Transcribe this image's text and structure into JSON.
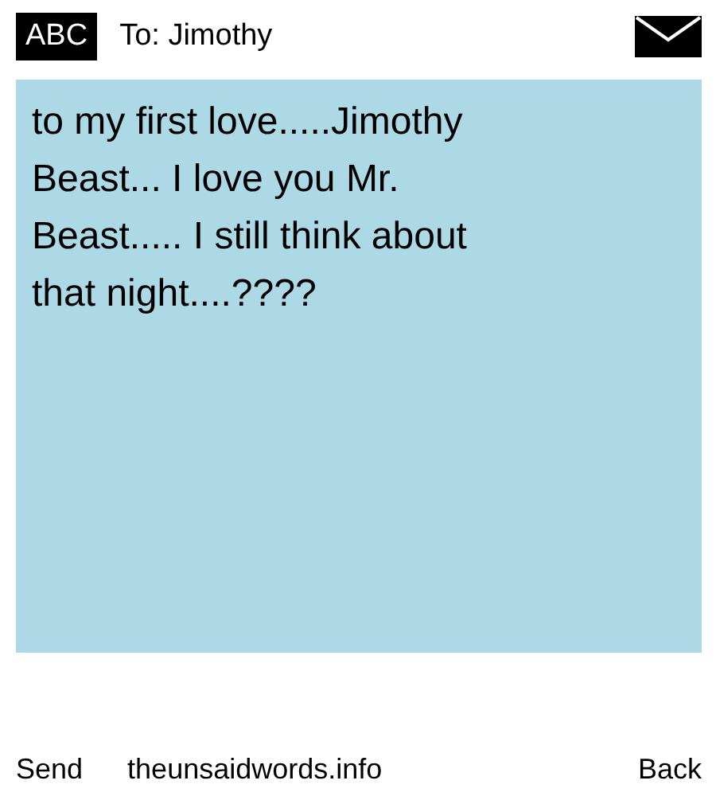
{
  "header": {
    "mode": "ABC",
    "recipient": "To: Jimothy"
  },
  "message": "to my first love.....Jimothy Beast... I love you Mr. Beast..... I still think about that night....????",
  "footer": {
    "left": "Send",
    "site": "theunsaidwords.info",
    "right": "Back"
  }
}
